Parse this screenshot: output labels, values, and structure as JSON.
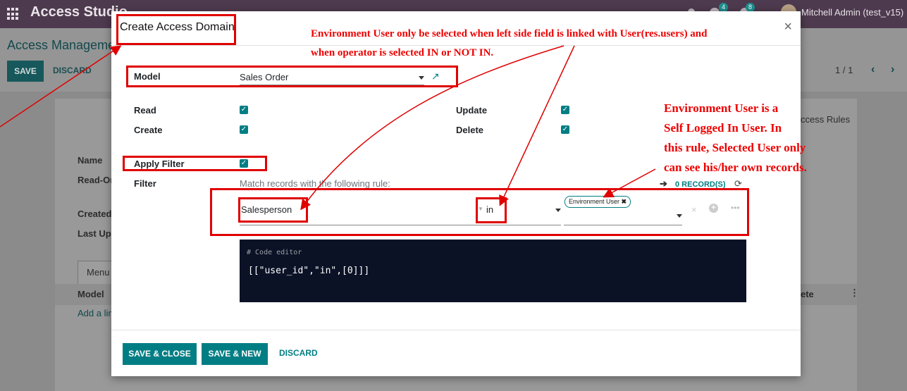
{
  "topbar": {
    "app_title": "Access Studio",
    "user": "Mitchell Admin (test_v15)",
    "badge_chat": "4",
    "badge_activity": "8"
  },
  "background": {
    "breadcrumb": "Access Manageme",
    "save": "SAVE",
    "discard": "DISCARD",
    "pager": "1 / 1",
    "tab_access_rules": "ccess Rules",
    "field_name": "Name",
    "field_readonly": "Read-On",
    "field_created": "Created",
    "field_lastupd": "Last Upo",
    "tab_menu": "Menu",
    "col_model": "Model",
    "col_delete": "ete",
    "add_line": "Add a lin"
  },
  "modal": {
    "title": "Create Access Domain",
    "model_label": "Model",
    "model_value": "Sales Order",
    "read_label": "Read",
    "create_label": "Create",
    "update_label": "Update",
    "delete_label": "Delete",
    "apply_filter_label": "Apply Filter",
    "filter_label": "Filter",
    "filter_hint": "Match records with the following rule:",
    "records_count": "0 RECORD(S)",
    "rule_field": "Salesperson",
    "rule_operator": "in",
    "rule_value_tag": "Environment User",
    "code_comment": "# Code editor",
    "code_text": "[[\"user_id\",\"in\",[0]]]",
    "save_close": "SAVE & CLOSE",
    "save_new": "SAVE & NEW",
    "discard": "DISCARD"
  },
  "annotations": {
    "note1_line1": "Environment User only be selected when left side field is linked with User(res.users) and",
    "note1_line2": "when operator is selected IN or NOT IN.",
    "note2_line1": "Environment User is a",
    "note2_line2": "Self Logged In User. In",
    "note2_line3": "this rule, Selected User only",
    "note2_line4": "can see his/her own records."
  },
  "colors": {
    "accent": "#017e84",
    "annotation": "#e00000",
    "topbar": "#4e3a4e"
  }
}
